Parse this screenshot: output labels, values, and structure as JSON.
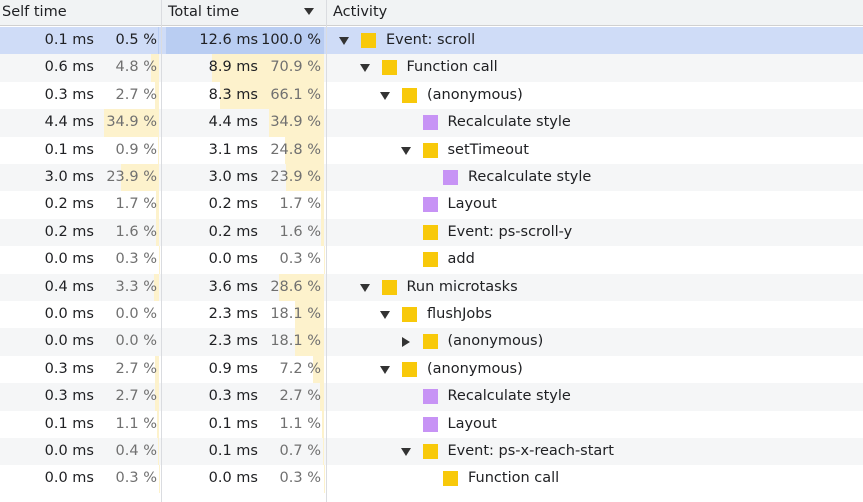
{
  "header": {
    "self_time": "Self time",
    "total_time": "Total time",
    "activity": "Activity",
    "sort_icon": "sort-descending-icon"
  },
  "colors": {
    "scripting": "#f8c90a",
    "rendering": "#c793f5",
    "selection": "#cfdcf7",
    "bar": "#fdf2cc"
  },
  "rows": [
    {
      "self_ms": "0.1 ms",
      "self_pct": "0.5 %",
      "self_frac": 0.005,
      "total_ms": "12.6 ms",
      "total_pct": "100.0 %",
      "total_frac": 1.0,
      "depth": 0,
      "toggle": "expanded",
      "category": "scripting",
      "label": "Event: scroll",
      "selected": true
    },
    {
      "self_ms": "0.6 ms",
      "self_pct": "4.8 %",
      "self_frac": 0.048,
      "total_ms": "8.9 ms",
      "total_pct": "70.9 %",
      "total_frac": 0.709,
      "depth": 1,
      "toggle": "expanded",
      "category": "scripting",
      "label": "Function call"
    },
    {
      "self_ms": "0.3 ms",
      "self_pct": "2.7 %",
      "self_frac": 0.027,
      "total_ms": "8.3 ms",
      "total_pct": "66.1 %",
      "total_frac": 0.661,
      "depth": 2,
      "toggle": "expanded",
      "category": "scripting",
      "label": "(anonymous)"
    },
    {
      "self_ms": "4.4 ms",
      "self_pct": "34.9 %",
      "self_frac": 0.349,
      "total_ms": "4.4 ms",
      "total_pct": "34.9 %",
      "total_frac": 0.349,
      "depth": 3,
      "toggle": "none",
      "category": "rendering",
      "label": "Recalculate style"
    },
    {
      "self_ms": "0.1 ms",
      "self_pct": "0.9 %",
      "self_frac": 0.009,
      "total_ms": "3.1 ms",
      "total_pct": "24.8 %",
      "total_frac": 0.248,
      "depth": 3,
      "toggle": "expanded",
      "category": "scripting",
      "label": "setTimeout"
    },
    {
      "self_ms": "3.0 ms",
      "self_pct": "23.9 %",
      "self_frac": 0.239,
      "total_ms": "3.0 ms",
      "total_pct": "23.9 %",
      "total_frac": 0.239,
      "depth": 4,
      "toggle": "none",
      "category": "rendering",
      "label": "Recalculate style"
    },
    {
      "self_ms": "0.2 ms",
      "self_pct": "1.7 %",
      "self_frac": 0.017,
      "total_ms": "0.2 ms",
      "total_pct": "1.7 %",
      "total_frac": 0.017,
      "depth": 3,
      "toggle": "none",
      "category": "rendering",
      "label": "Layout"
    },
    {
      "self_ms": "0.2 ms",
      "self_pct": "1.6 %",
      "self_frac": 0.016,
      "total_ms": "0.2 ms",
      "total_pct": "1.6 %",
      "total_frac": 0.016,
      "depth": 3,
      "toggle": "none",
      "category": "scripting",
      "label": "Event: ps-scroll-y"
    },
    {
      "self_ms": "0.0 ms",
      "self_pct": "0.3 %",
      "self_frac": 0.003,
      "total_ms": "0.0 ms",
      "total_pct": "0.3 %",
      "total_frac": 0.003,
      "depth": 3,
      "toggle": "none",
      "category": "scripting",
      "label": "add"
    },
    {
      "self_ms": "0.4 ms",
      "self_pct": "3.3 %",
      "self_frac": 0.033,
      "total_ms": "3.6 ms",
      "total_pct": "28.6 %",
      "total_frac": 0.286,
      "depth": 1,
      "toggle": "expanded",
      "category": "scripting",
      "label": "Run microtasks"
    },
    {
      "self_ms": "0.0 ms",
      "self_pct": "0.0 %",
      "self_frac": 0.0,
      "total_ms": "2.3 ms",
      "total_pct": "18.1 %",
      "total_frac": 0.181,
      "depth": 2,
      "toggle": "expanded",
      "category": "scripting",
      "label": "flushJobs"
    },
    {
      "self_ms": "0.0 ms",
      "self_pct": "0.0 %",
      "self_frac": 0.0,
      "total_ms": "2.3 ms",
      "total_pct": "18.1 %",
      "total_frac": 0.181,
      "depth": 3,
      "toggle": "collapsed",
      "category": "scripting",
      "label": "(anonymous)"
    },
    {
      "self_ms": "0.3 ms",
      "self_pct": "2.7 %",
      "self_frac": 0.027,
      "total_ms": "0.9 ms",
      "total_pct": "7.2 %",
      "total_frac": 0.072,
      "depth": 2,
      "toggle": "expanded",
      "category": "scripting",
      "label": "(anonymous)"
    },
    {
      "self_ms": "0.3 ms",
      "self_pct": "2.7 %",
      "self_frac": 0.027,
      "total_ms": "0.3 ms",
      "total_pct": "2.7 %",
      "total_frac": 0.027,
      "depth": 3,
      "toggle": "none",
      "category": "rendering",
      "label": "Recalculate style"
    },
    {
      "self_ms": "0.1 ms",
      "self_pct": "1.1 %",
      "self_frac": 0.011,
      "total_ms": "0.1 ms",
      "total_pct": "1.1 %",
      "total_frac": 0.011,
      "depth": 3,
      "toggle": "none",
      "category": "rendering",
      "label": "Layout"
    },
    {
      "self_ms": "0.0 ms",
      "self_pct": "0.4 %",
      "self_frac": 0.004,
      "total_ms": "0.1 ms",
      "total_pct": "0.7 %",
      "total_frac": 0.007,
      "depth": 3,
      "toggle": "expanded",
      "category": "scripting",
      "label": "Event: ps-x-reach-start"
    },
    {
      "self_ms": "0.0 ms",
      "self_pct": "0.3 %",
      "self_frac": 0.003,
      "total_ms": "0.0 ms",
      "total_pct": "0.3 %",
      "total_frac": 0.003,
      "depth": 4,
      "toggle": "none",
      "category": "scripting",
      "label": "Function call"
    }
  ]
}
